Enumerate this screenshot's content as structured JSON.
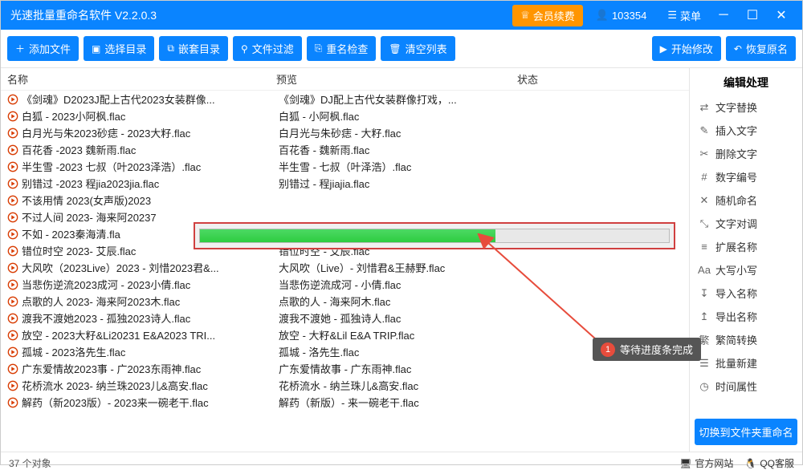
{
  "app": {
    "title": "光速批量重命名软件 V2.2.0.3",
    "vip": "会员续费",
    "user_id": "103354",
    "menu": "菜单"
  },
  "toolbar": {
    "add_file": "添加文件",
    "select_dir": "选择目录",
    "nested_dir": "嵌套目录",
    "file_filter": "文件过滤",
    "dup_check": "重名检查",
    "clear_list": "清空列表",
    "start": "开始修改",
    "restore": "恢复原名"
  },
  "columns": {
    "name": "名称",
    "preview": "预览",
    "status": "状态"
  },
  "rows": [
    {
      "n": "《剑魂》D2023J配上古代2023女装群像...",
      "p": "《剑魂》DJ配上古代女装群像打戏，..."
    },
    {
      "n": "白狐 - 2023小阿枫.flac",
      "p": "白狐 - 小阿枫.flac"
    },
    {
      "n": "白月光与朱2023砂痣 - 2023大籽.flac",
      "p": "白月光与朱砂痣 - 大籽.flac"
    },
    {
      "n": "百花香 -2023 魏新雨.flac",
      "p": "百花香 - 魏新雨.flac"
    },
    {
      "n": "半生雪 -2023 七叔（叶2023泽浩）.flac",
      "p": "半生雪 - 七叔（叶泽浩）.flac"
    },
    {
      "n": "别错过 -2023 程jia2023jia.flac",
      "p": "别错过 - 程jiajia.flac"
    },
    {
      "n": "不该用情 2023(女声版)2023",
      "p": ""
    },
    {
      "n": "不过人间 2023- 海来阿20237",
      "p": ""
    },
    {
      "n": "不如 - 2023秦海清.fla",
      "p": ""
    },
    {
      "n": "错位时空 2023- 艾辰.flac",
      "p": "错位时空 - 艾辰.flac"
    },
    {
      "n": "大风吹（2023Live）2023 - 刘惜2023君&...",
      "p": "大风吹（Live）- 刘惜君&王赫野.flac"
    },
    {
      "n": "当悲伤逆流2023成河 - 2023小倩.flac",
      "p": "当悲伤逆流成河 - 小倩.flac"
    },
    {
      "n": "点歌的人 2023- 海来阿2023木.flac",
      "p": "点歌的人 - 海来阿木.flac"
    },
    {
      "n": "渡我不渡她2023 - 孤独2023诗人.flac",
      "p": "渡我不渡她 - 孤独诗人.flac"
    },
    {
      "n": "放空 - 2023大籽&Li20231 E&A2023 TRI...",
      "p": "放空 - 大籽&Lil E&A TRIP.flac"
    },
    {
      "n": "孤城 - 2023洛先生.flac",
      "p": "孤城 - 洛先生.flac"
    },
    {
      "n": "广东爱情故2023事 - 广2023东雨神.flac",
      "p": "广东爱情故事 - 广东雨神.flac"
    },
    {
      "n": "花桥流水 2023- 纳兰珠2023儿&高安.flac",
      "p": "花桥流水 - 纳兰珠儿&高安.flac"
    },
    {
      "n": "解药（新2023版）- 2023来一碗老干.flac",
      "p": "解药（新版）- 来一碗老干.flac"
    }
  ],
  "side": {
    "title": "编辑处理",
    "items": [
      {
        "i": "⇄",
        "t": "文字替换"
      },
      {
        "i": "✎",
        "t": "插入文字"
      },
      {
        "i": "✂",
        "t": "删除文字"
      },
      {
        "i": "#",
        "t": "数字编号"
      },
      {
        "i": "✕",
        "t": "随机命名"
      },
      {
        "i": "⤡",
        "t": "文字对调"
      },
      {
        "i": "≡",
        "t": "扩展名称"
      },
      {
        "i": "Aa",
        "t": "大写小写"
      },
      {
        "i": "↧",
        "t": "导入名称"
      },
      {
        "i": "↥",
        "t": "导出名称"
      },
      {
        "i": "繁",
        "t": "繁简转换"
      },
      {
        "i": "☰",
        "t": "批量新建"
      },
      {
        "i": "◷",
        "t": "时间属性"
      }
    ],
    "switch": "切换到文件夹重命名"
  },
  "status": {
    "count": "37 个对象",
    "official": "官方网站",
    "qq": "QQ客服"
  },
  "annotation": {
    "num": "1",
    "text": "等待进度条完成"
  }
}
